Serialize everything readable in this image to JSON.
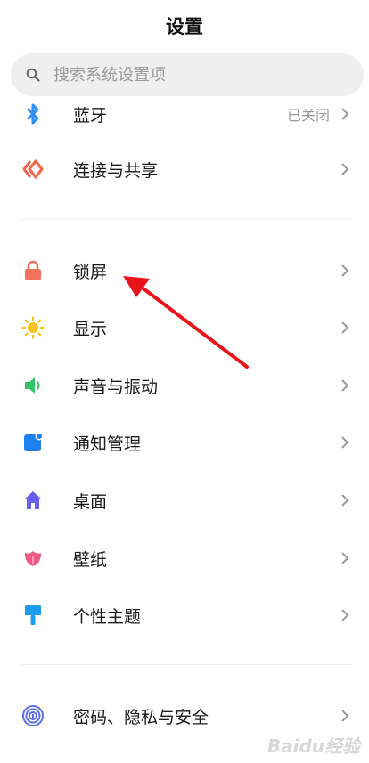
{
  "header": {
    "title": "设置"
  },
  "search": {
    "placeholder": "搜索系统设置项"
  },
  "items": [
    {
      "label": "蓝牙",
      "value": "已关闭"
    },
    {
      "label": "连接与共享"
    },
    {
      "label": "锁屏"
    },
    {
      "label": "显示"
    },
    {
      "label": "声音与振动"
    },
    {
      "label": "通知管理"
    },
    {
      "label": "桌面"
    },
    {
      "label": "壁纸"
    },
    {
      "label": "个性主题"
    },
    {
      "label": "密码、隐私与安全"
    }
  ],
  "watermark": "Baidu经验",
  "colors": {
    "bluetooth": "#2b8ff5",
    "connect": "#f06a52",
    "lock": "#f4715e",
    "display": "#f7c31a",
    "sound": "#36c46b",
    "notification": "#1e7ff0",
    "desktop": "#6a5ff0",
    "wallpaper": "#ef5a83",
    "theme": "#1e9cf0",
    "privacy": "#5a6ef0",
    "annotation_arrow": "#e8141a"
  }
}
